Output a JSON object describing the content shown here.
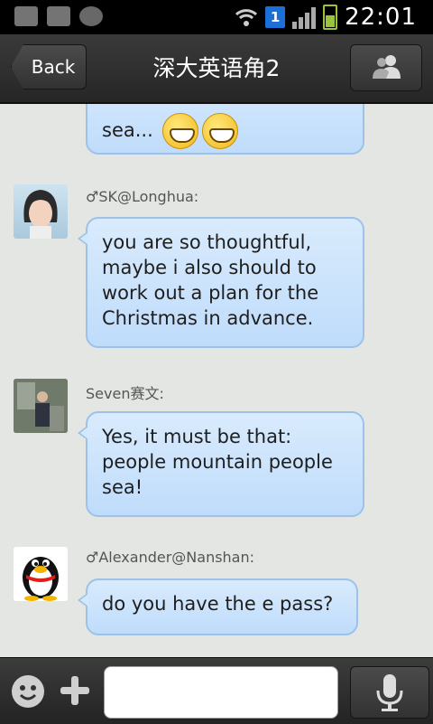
{
  "status_bar": {
    "time": "22:01",
    "notification_count": "1"
  },
  "header": {
    "back_label": "Back",
    "title": "深大英语角2"
  },
  "messages": [
    {
      "text": "sea...",
      "emoji": [
        "grinning-face",
        "grinning-face"
      ]
    },
    {
      "sender": "♂SK@Longhua:",
      "text": "you are so thoughtful, maybe i also should to work out a plan for the Christmas in advance."
    },
    {
      "sender": "Seven赛文:",
      "text": "Yes, it must be that: people mountain people sea!"
    },
    {
      "sender": "♂Alexander@Nanshan:",
      "text": "do you have the e pass?"
    }
  ],
  "input": {
    "placeholder": ""
  },
  "colors": {
    "bubble": "#cde4fc",
    "bubble_border": "#9cc2e9",
    "header": "#2e2e2e",
    "background": "#e4e6e3"
  }
}
